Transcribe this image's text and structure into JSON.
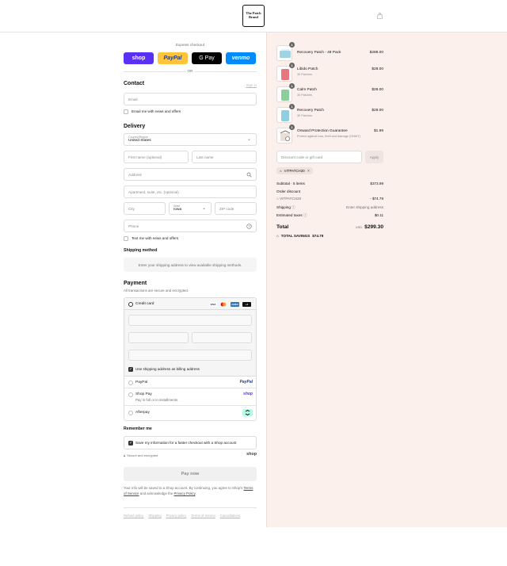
{
  "brand": {
    "logo_text": "The Patch Brand",
    "cart_icon": "shopping-bag-icon"
  },
  "express": {
    "title": "Express checkout",
    "buttons": [
      {
        "label": "shop"
      },
      {
        "label": "PayPal"
      },
      {
        "label": "G Pay"
      },
      {
        "label": "venmo"
      }
    ],
    "or_label": "OR"
  },
  "contact": {
    "heading": "Contact",
    "signin_label": "Sign in",
    "email_placeholder": "Email",
    "email_news_label": "Email me with news and offers"
  },
  "delivery": {
    "heading": "Delivery",
    "country_label": "Country/Region",
    "country_value": "United States",
    "first_name_placeholder": "First name (optional)",
    "last_name_placeholder": "Last name",
    "address_placeholder": "Address",
    "apartment_placeholder": "Apartment, suite, etc. (optional)",
    "city_placeholder": "City",
    "state_label": "State",
    "state_value": "Iowa",
    "zip_placeholder": "ZIP code",
    "phone_placeholder": "Phone",
    "text_news_label": "Text me with news and offers"
  },
  "shipping_method": {
    "heading": "Shipping method",
    "message": "Enter your shipping address to view available shipping methods."
  },
  "payment": {
    "heading": "Payment",
    "subtitle": "All transactions are secure and encrypted.",
    "credit_card_label": "Credit card",
    "card_brands": [
      "VISA",
      "MC",
      "AMEX",
      "+4"
    ],
    "billing_same_label": "Use shipping address as billing address",
    "paypal_label": "PayPal",
    "paypal_logo": "PayPal",
    "shoppay_label": "Shop Pay",
    "shoppay_sub": "Pay in full or in installments",
    "shoppay_logo": "shop",
    "afterpay_label": "Afterpay"
  },
  "remember": {
    "heading": "Remember me",
    "save_label": "Save my information for a faster checkout with a Shop account",
    "secure_label": "Secure and encrypted",
    "shop_logo": "shop"
  },
  "pay_now_label": "Pay now",
  "legal": {
    "text_1": "Your info will be saved to a Shop account. By continuing, you agree to Shop's",
    "terms": "Terms of Service",
    "text_2": "and acknowledge the",
    "privacy": "Privacy Policy",
    "end": "."
  },
  "policies": [
    "Refund policy",
    "Shipping",
    "Privacy policy",
    "Terms of service",
    "Cancellations"
  ],
  "summary": {
    "items": [
      {
        "name": "Recovery Patch - 48 Pack",
        "sub": "",
        "price": "$288.00",
        "qty": "1",
        "color": "#9fd3e3"
      },
      {
        "name": "Libido Patch",
        "sub": "30 Patches",
        "price": "$28.00",
        "qty": "1",
        "color": "#e9757d"
      },
      {
        "name": "Calm Patch",
        "sub": "30 Patches",
        "price": "$28.00",
        "qty": "1",
        "color": "#8ccf9c"
      },
      {
        "name": "Recovery Patch",
        "sub": "30 Patches",
        "price": "$28.00",
        "qty": "1",
        "color": "#8fd0e0"
      },
      {
        "name": "Onward Protection Guarantee",
        "sub": "Protect against loss, theft and damage (ONWT)",
        "price": "$1.99",
        "qty": "1",
        "color": "#c0a396"
      }
    ],
    "discount_placeholder": "Discount code or gift card",
    "apply_label": "Apply",
    "applied_code": "VITPATCH20",
    "subtotal_label": "Subtotal · 5 items",
    "subtotal_value": "$373.99",
    "order_discount_label": "Order discount",
    "discount_code": "VITPATCH20",
    "discount_value": "- $74.79",
    "shipping_label": "Shipping",
    "shipping_value": "Enter shipping address",
    "taxes_label": "Estimated taxes",
    "taxes_value": "$0.11",
    "total_label": "Total",
    "currency": "USD",
    "total_value": "$299.30",
    "savings_label": "TOTAL SAVINGS",
    "savings_value": "$74.79"
  }
}
